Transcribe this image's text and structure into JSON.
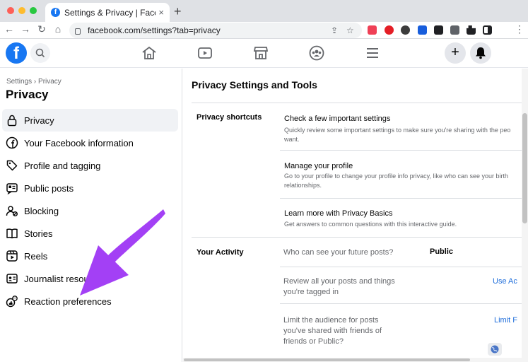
{
  "browser": {
    "tab_title": "Settings & Privacy | Facebook",
    "tab_close": "×",
    "new_tab": "+",
    "url": "facebook.com/settings?tab=privacy",
    "back": "←",
    "forward": "→",
    "reload": "↻",
    "home": "⌂",
    "share": "⇪",
    "bookmark": "☆",
    "menu": "⋮"
  },
  "fb_header": {
    "logo": "f",
    "create": "+"
  },
  "sidebar": {
    "breadcrumb": "Settings › Privacy",
    "title": "Privacy",
    "items": [
      {
        "label": "Privacy",
        "icon": "lock-icon"
      },
      {
        "label": "Your Facebook information",
        "icon": "facebook-icon"
      },
      {
        "label": "Profile and tagging",
        "icon": "tag-icon"
      },
      {
        "label": "Public posts",
        "icon": "public-posts-icon"
      },
      {
        "label": "Blocking",
        "icon": "blocking-icon"
      },
      {
        "label": "Stories",
        "icon": "book-icon"
      },
      {
        "label": "Reels",
        "icon": "reels-icon"
      },
      {
        "label": "Journalist resou",
        "icon": "journalist-icon"
      },
      {
        "label": "Reaction preferences",
        "icon": "reaction-icon"
      }
    ]
  },
  "main": {
    "title": "Privacy Settings and Tools",
    "shortcuts_label": "Privacy shortcuts",
    "shortcuts": [
      {
        "title": "Check a few important settings",
        "desc": "Quickly review some important settings to make sure you're sharing with the peo want."
      },
      {
        "title": "Manage your profile",
        "desc": "Go to your profile to change your profile info privacy, like who can see your birth relationships."
      },
      {
        "title": "Learn more with Privacy Basics",
        "desc": "Get answers to common questions with this interactive guide."
      }
    ],
    "activity_label": "Your Activity",
    "activity": [
      {
        "text": "Who can see your future posts?",
        "value": "Public",
        "link": ""
      },
      {
        "text": "Review all your posts and things you're tagged in",
        "value": "",
        "link": "Use Ac"
      },
      {
        "text": "Limit the audience for posts you've shared with friends of friends or Public?",
        "value": "",
        "link": "Limit F"
      }
    ]
  },
  "colors": {
    "fb_blue": "#1877f2",
    "link_blue": "#216fdb",
    "arrow_purple": "#a340f5"
  }
}
